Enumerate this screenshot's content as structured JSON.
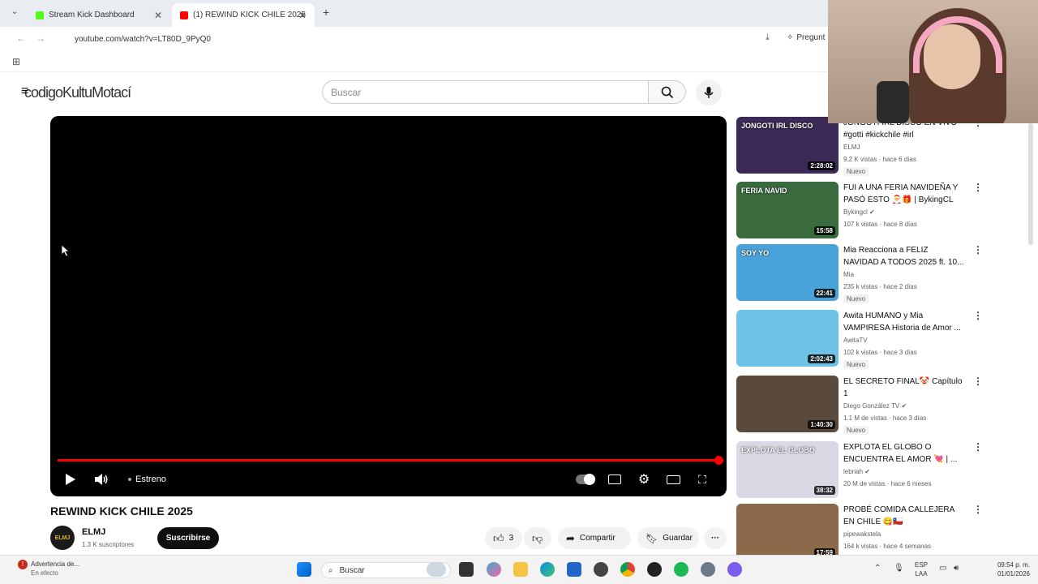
{
  "browser": {
    "tab1_title": "Stream Kick Dashboard",
    "tab2_title": "(1) REWIND KICK CHILE 2025",
    "new_tab": "+",
    "url": "youtube.com/watch?v=LT80D_9PyQ0",
    "ask_label": "Pregunt"
  },
  "overlay": {
    "glitch_text": "codigoKultuMotací"
  },
  "header": {
    "search_placeholder": "Buscar"
  },
  "player": {
    "status_label": "Estreno",
    "progress": 1.0
  },
  "video": {
    "title": "REWIND KICK CHILE 2025",
    "channel": "ELMJ",
    "avatar_text": "ELMJ",
    "subscribers": "1.3 K suscriptores",
    "subscribe_label": "Suscribirse",
    "likes": "3",
    "share_label": "Compartir",
    "save_label": "Guardar"
  },
  "recommendations": [
    {
      "title": "JONGOTI IRL DISCO EN VIVO #gotti #kickchile #irl",
      "channel": "ELMJ",
      "meta": "9.2 K vistas · hace 6 días",
      "badge": "Nuevo",
      "duration": "2:28:02",
      "thumb_text": "JONGOTI IRL DISCO",
      "color": "#3b2a55"
    },
    {
      "title": "FUI A UNA FERIA NAVIDEÑA Y PASÓ ESTO 🎅🎁 | BykingCL",
      "channel": "Bykingcl ✔",
      "meta": "107 k vistas · hace 8 días",
      "badge": "",
      "duration": "15:58",
      "thumb_text": "FERIA NAVID",
      "color": "#3a6b3f"
    },
    {
      "title": "Mia Reacciona a FELIZ NAVIDAD A TODOS 2025 ft. 10...",
      "channel": "Mia",
      "meta": "235 k vistas · hace 2 días",
      "badge": "Nuevo",
      "duration": "22:41",
      "thumb_text": "SOY YO",
      "color": "#4aa3d8"
    },
    {
      "title": "Awita HUMANO y Mia VAMPIRESA Historia de Amor ...",
      "channel": "AwitaTV",
      "meta": "102 k vistas · hace 3 días",
      "badge": "Nuevo",
      "duration": "2:02:43",
      "thumb_text": "",
      "color": "#6ec3e6"
    },
    {
      "title": "EL SECRETO FINAL🤡 Capítulo 1",
      "channel": "Diego González TV ✔",
      "meta": "1.1 M de vistas · hace 3 días",
      "badge": "Nuevo",
      "duration": "1:40:30",
      "thumb_text": "",
      "color": "#5a4a3e"
    },
    {
      "title": "EXPLOTA EL GLOBO O ENCUENTRA EL AMOR 💘 | ...",
      "channel": "lebriah ✔",
      "meta": "20 M de vistas · hace 6 meses",
      "badge": "",
      "duration": "38:32",
      "thumb_text": "EXPLOTA EL GLOBO",
      "color": "#d9d9e6"
    },
    {
      "title": "PROBÉ COMIDA CALLEJERA EN CHILE 😋🇨🇱",
      "channel": "pipewakstela",
      "meta": "164 k vistas · hace 4 semanas",
      "badge": "",
      "duration": "17:59",
      "thumb_text": "",
      "color": "#8a6a4a"
    }
  ],
  "taskbar": {
    "notif_title": "Advertencia de...",
    "notif_sub": "En efecto",
    "search_label": "Buscar",
    "lang": "ESP",
    "lang_sub": "LAA",
    "time": "09:54 p. m.",
    "date": "01/01/2026"
  }
}
